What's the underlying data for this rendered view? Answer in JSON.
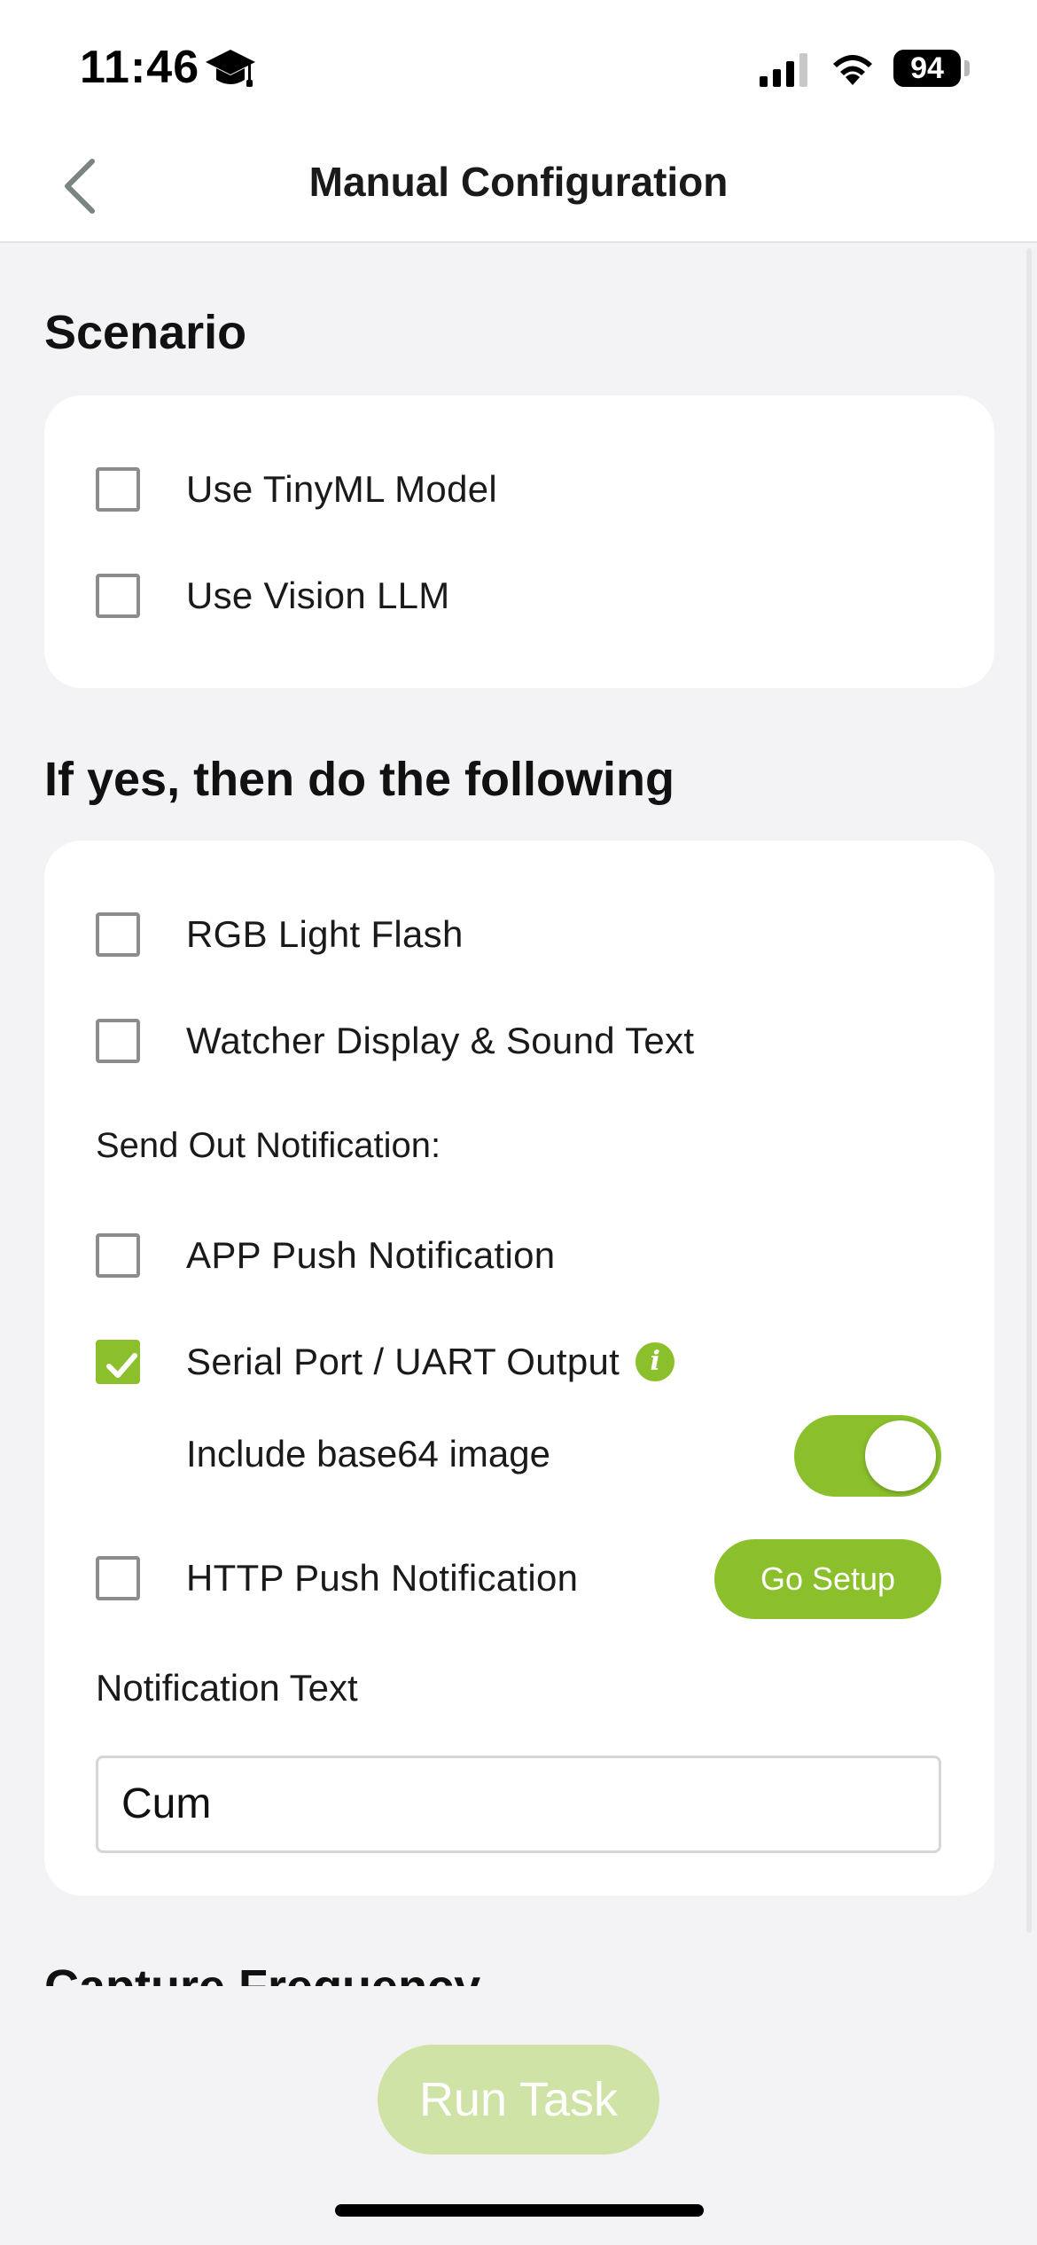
{
  "status_bar": {
    "time": "11:46",
    "battery": "94"
  },
  "nav": {
    "title": "Manual Configuration"
  },
  "scenario": {
    "heading": "Scenario",
    "options": [
      {
        "label": "Use TinyML Model",
        "checked": false
      },
      {
        "label": "Use Vision LLM",
        "checked": false
      }
    ]
  },
  "actions": {
    "heading": "If yes, then do the following",
    "rgb_light_flash": "RGB Light Flash",
    "watcher_display": "Watcher Display & Sound Text",
    "send_out_label": "Send Out Notification:",
    "app_push": "APP Push Notification",
    "serial_port": "Serial Port / UART Output",
    "serial_port_checked": true,
    "include_base64": "Include base64 image",
    "include_base64_on": true,
    "http_push": "HTTP Push Notification",
    "go_setup": "Go Setup",
    "notification_text_label": "Notification Text",
    "notification_text_value": "Cum"
  },
  "capture": {
    "heading": "Capture Frequency"
  },
  "footer": {
    "run_task": "Run Task"
  },
  "colors": {
    "accent": "#8bc02c",
    "accent_disabled": "#cfe3a6",
    "background": "#f3f3f6"
  }
}
